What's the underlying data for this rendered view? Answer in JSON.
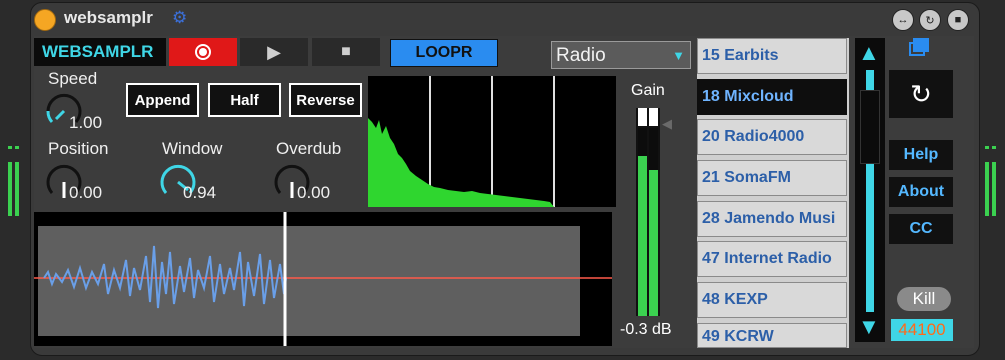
{
  "titlebar": {
    "title": "websamplr"
  },
  "header": {
    "brand": "WEBSAMPLR",
    "loopr_label": "LOOPR",
    "source_selected": "Radio"
  },
  "controls": {
    "speed": {
      "label": "Speed",
      "value": "1.00"
    },
    "position": {
      "label": "Position",
      "value": "0.00"
    },
    "window": {
      "label": "Window",
      "value": "0.94"
    },
    "overdub": {
      "label": "Overdub",
      "value": "0.00"
    },
    "append_label": "Append",
    "half_label": "Half",
    "reverse_label": "Reverse"
  },
  "gain": {
    "label": "Gain",
    "value": "-0.3 dB"
  },
  "stations": [
    "15 Earbits",
    "18 Mixcloud",
    "20 Radio4000",
    "21 SomaFM",
    "28 Jamendo Musi",
    "47 Internet Radio",
    "48 KEXP",
    "49 KCRW"
  ],
  "side_menu": {
    "help_label": "Help",
    "about_label": "About",
    "cc_label": "CC",
    "kill_label": "Kill",
    "sample_rate": "44100"
  },
  "colors": {
    "accent_cyan": "#3fd6e6",
    "record_red": "#e01818",
    "loopr_blue": "#2a8cf0",
    "spectrum_green": "#2fd62f",
    "waveform_blue": "#6a9fe8",
    "orange": "#f5a623"
  }
}
